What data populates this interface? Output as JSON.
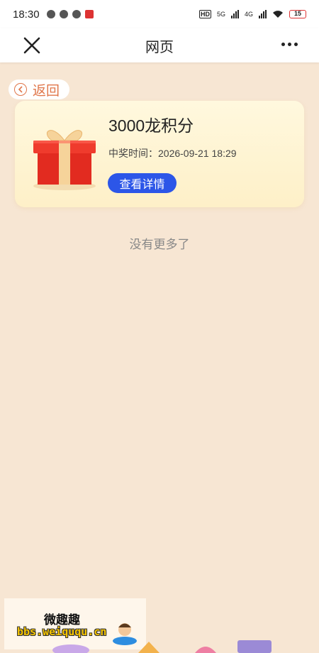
{
  "status_bar": {
    "time": "18:30",
    "network_1": "5G",
    "network_2": "4G",
    "battery": "15"
  },
  "navbar": {
    "title": "网页"
  },
  "back": {
    "label": "返回"
  },
  "prize": {
    "title": "3000龙积分",
    "time_label": "中奖时间：",
    "time_value": "2026-09-21 18:29",
    "detail_button": "查看详情"
  },
  "list_end_text": "没有更多了",
  "watermark": {
    "title": "微趣趣",
    "url": "bbs.weiququ.cn"
  },
  "colors": {
    "page_bg": "#f7e6d3",
    "accent_orange": "#e0764a",
    "button_blue": "#2c56e8",
    "card_bg": "#fff8de"
  },
  "icons": {
    "close": "close-icon",
    "more": "more-dots-icon",
    "back": "chevron-left-icon",
    "gift": "gift-box-icon"
  }
}
